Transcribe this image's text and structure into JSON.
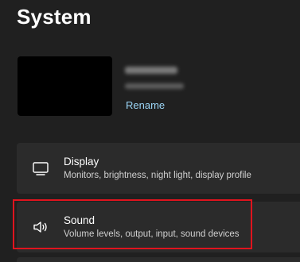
{
  "page": {
    "title": "System"
  },
  "device": {
    "rename_label": "Rename"
  },
  "cards": {
    "display": {
      "icon": "monitor-icon",
      "title": "Display",
      "subtitle": "Monitors, brightness, night light, display profile"
    },
    "sound": {
      "icon": "speaker-icon",
      "title": "Sound",
      "subtitle": "Volume levels, output, input, sound devices"
    }
  },
  "colors": {
    "background": "#202020",
    "card": "#2b2b2b",
    "link": "#9ad4f5",
    "highlight": "#e0141e"
  }
}
